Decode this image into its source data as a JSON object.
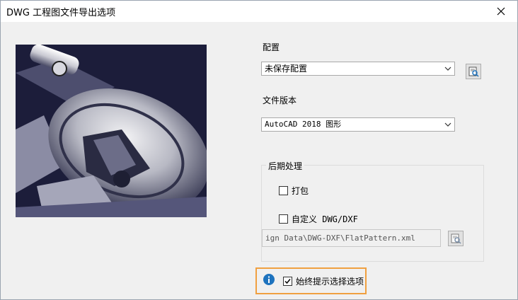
{
  "window": {
    "title": "DWG 工程图文件导出选项"
  },
  "config": {
    "label": "配置",
    "selected": "未保存配置"
  },
  "file_version": {
    "label": "文件版本",
    "selected": "AutoCAD 2018 图形"
  },
  "post_processing": {
    "title": "后期处理",
    "pack_label": "打包",
    "pack_checked": false,
    "custom_label": "自定义 DWG/DXF",
    "custom_checked": false,
    "custom_path": "ign Data\\DWG-DXF\\FlatPattern.xml"
  },
  "always_prompt": {
    "label": "始终提示选择选项",
    "checked": true
  },
  "colors": {
    "accent_highlight": "#f0a040",
    "info_blue": "#1e73be"
  },
  "icons": {
    "close": "close-icon",
    "browse_config": "config-browse-icon",
    "browse_path": "file-browse-icon",
    "info": "info-icon"
  }
}
